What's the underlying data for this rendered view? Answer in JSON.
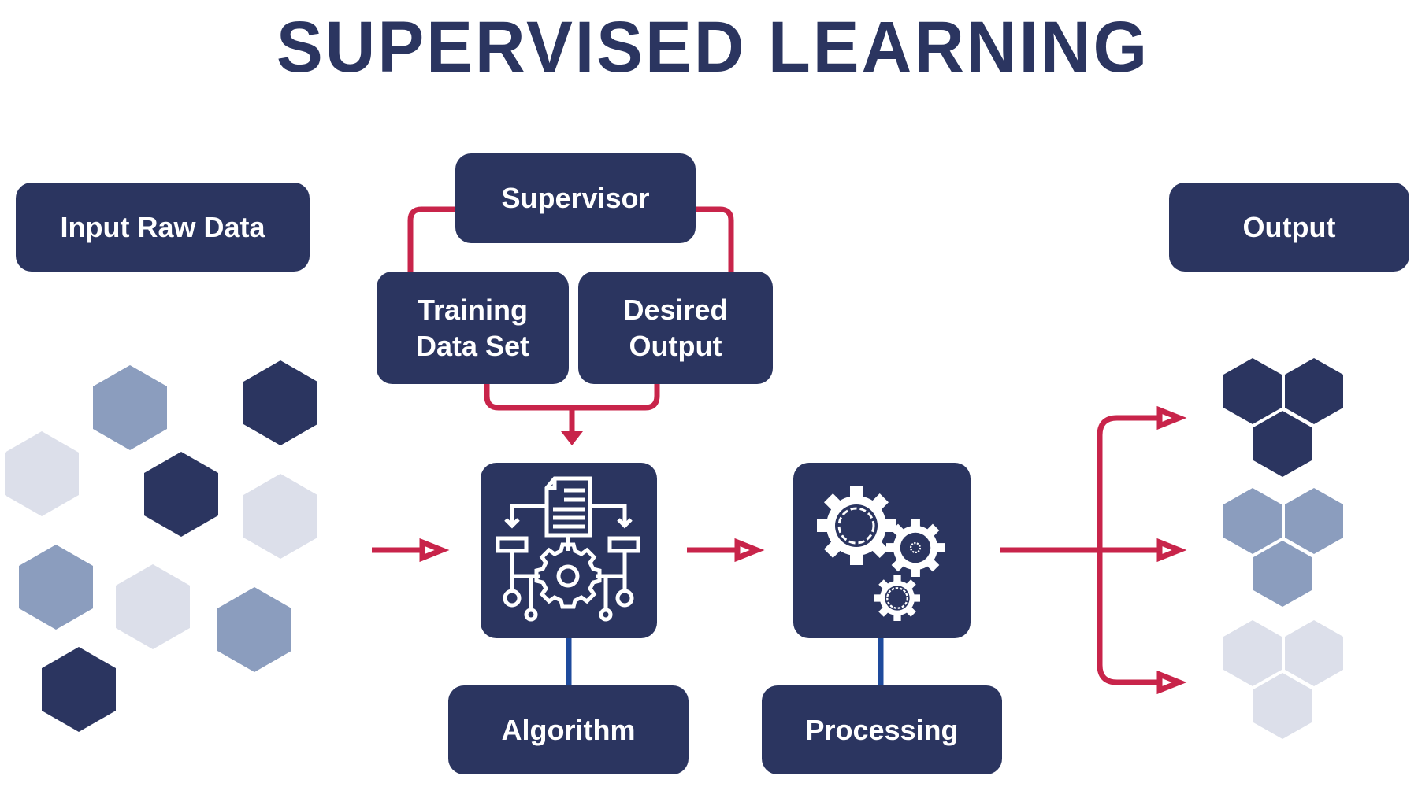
{
  "title": "SUPERVISED LEARNING",
  "colors": {
    "navy": "#2B3560",
    "connector_red": "#C8244A",
    "connector_blue": "#1E4A9C",
    "hex_dark": "#2B3560",
    "hex_medium": "#8B9DBE",
    "hex_light": "#DCDFEA",
    "text_on_box": "#FFFFFF"
  },
  "nodes": {
    "input": {
      "label": "Input Raw Data"
    },
    "supervisor": {
      "label": "Supervisor"
    },
    "training": {
      "label_line1": "Training",
      "label_line2": "Data Set"
    },
    "desired": {
      "label_line1": "Desired",
      "label_line2": "Output"
    },
    "output": {
      "label": "Output"
    },
    "algorithm": {
      "label": "Algorithm",
      "icon": "algorithm-flowchart-icon"
    },
    "processing": {
      "label": "Processing",
      "icon": "gears-icon"
    }
  },
  "input_hexagons": [
    {
      "shade": "medium"
    },
    {
      "shade": "dark"
    },
    {
      "shade": "light"
    },
    {
      "shade": "dark"
    },
    {
      "shade": "light"
    },
    {
      "shade": "medium"
    },
    {
      "shade": "light"
    },
    {
      "shade": "medium"
    },
    {
      "shade": "dark"
    }
  ],
  "output_clusters": [
    {
      "shade": "dark",
      "count": 3
    },
    {
      "shade": "medium",
      "count": 3
    },
    {
      "shade": "light",
      "count": 3
    }
  ],
  "edges": [
    {
      "from": "supervisor",
      "to": "training"
    },
    {
      "from": "supervisor",
      "to": "desired"
    },
    {
      "from": [
        "training",
        "desired"
      ],
      "to": "algorithm"
    },
    {
      "from": "input",
      "to": "algorithm"
    },
    {
      "from": "algorithm",
      "to": "processing"
    },
    {
      "from": "processing",
      "to": "output",
      "branches": 3
    }
  ]
}
